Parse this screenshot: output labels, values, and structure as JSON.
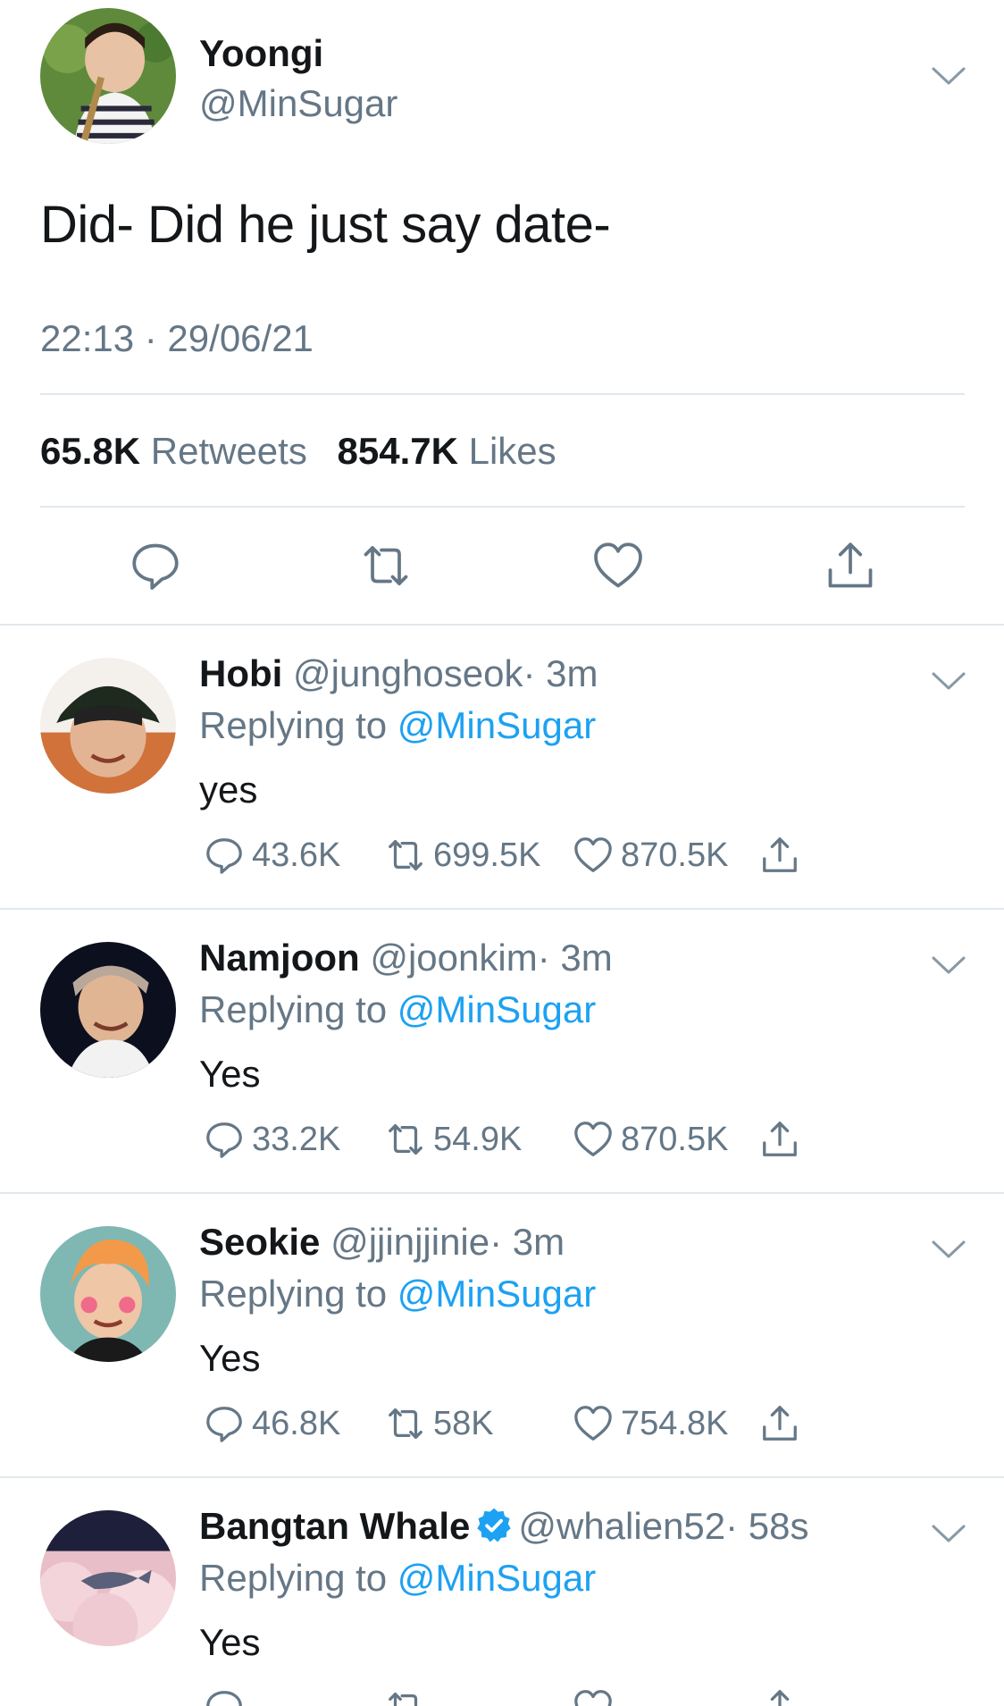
{
  "main_tweet": {
    "name": "Yoongi",
    "handle": "@MinSugar",
    "text": "Did- Did he just say date-",
    "timestamp": "22:13 · 29/06/21",
    "retweets_count": "65.8K",
    "retweets_label": "Retweets",
    "likes_count": "854.7K",
    "likes_label": "Likes",
    "actions": [
      "reply-icon",
      "retweet-icon",
      "like-icon",
      "share-icon"
    ]
  },
  "colors": {
    "text": "#14171a",
    "secondary": "#657786",
    "link": "#1da1f2",
    "divider": "#e1e8ed"
  },
  "replies": [
    {
      "name": "Hobi",
      "handle": "@junghoseok",
      "time": "· 3m",
      "replying_label": "Replying to",
      "replying_to": "@MinSugar",
      "text": "yes",
      "reply_count": "43.6K",
      "retweet_count": "699.5K",
      "like_count": "870.5K",
      "verified": false
    },
    {
      "name": "Namjoon",
      "handle": "@joonkim",
      "time": "· 3m",
      "replying_label": "Replying to",
      "replying_to": "@MinSugar",
      "text": "Yes",
      "reply_count": "33.2K",
      "retweet_count": "54.9K",
      "like_count": "870.5K",
      "verified": false
    },
    {
      "name": "Seokie",
      "handle": "@jjinjjinie",
      "time": "· 3m",
      "replying_label": "Replying to",
      "replying_to": "@MinSugar",
      "text": "Yes",
      "reply_count": "46.8K",
      "retweet_count": "58K",
      "like_count": "754.8K",
      "verified": false
    },
    {
      "name": "Bangtan Whale",
      "handle": "@whalien52",
      "time": "· 58s",
      "replying_label": "Replying to",
      "replying_to": "@MinSugar",
      "text": "Yes",
      "verified": true
    }
  ]
}
